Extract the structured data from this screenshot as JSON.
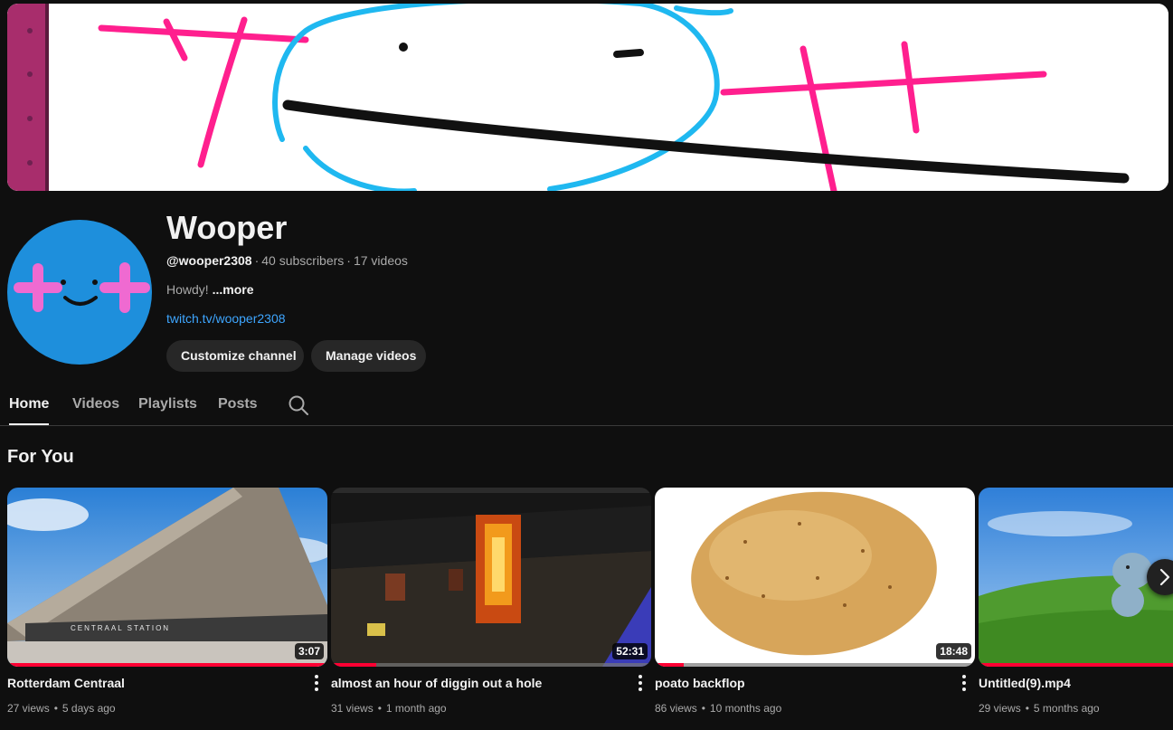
{
  "channel": {
    "name": "Wooper",
    "handle": "@wooper2308",
    "subscribers": "40 subscribers",
    "videos_count": "17 videos",
    "separator": "·",
    "description": "Howdy!",
    "more_label": "...more",
    "link": "twitch.tv/wooper2308",
    "customize_label": "Customize channel",
    "manage_label": "Manage videos"
  },
  "tabs": [
    {
      "label": "Home",
      "active": true
    },
    {
      "label": "Videos",
      "active": false
    },
    {
      "label": "Playlists",
      "active": false
    },
    {
      "label": "Posts",
      "active": false
    }
  ],
  "section": {
    "title": "For You"
  },
  "videos": [
    {
      "title": "Rotterdam Centraal",
      "duration": "3:07",
      "views": "27 views",
      "age": "5 days ago",
      "watched_fraction": 1.0
    },
    {
      "title": "almost an hour of diggin out a hole",
      "duration": "52:31",
      "views": "31 views",
      "age": "1 month ago",
      "watched_fraction": 0.14
    },
    {
      "title": "poato backflop",
      "duration": "18:48",
      "views": "86 views",
      "age": "10 months ago",
      "watched_fraction": 0.09
    },
    {
      "title": "Untitled(9).mp4",
      "duration": "",
      "views": "29 views",
      "age": "5 months ago",
      "watched_fraction": 1.0
    }
  ],
  "stats_separator": "•",
  "colors": {
    "background": "#0f0f0f",
    "accent_link": "#3ea6ff",
    "progress": "#ff0033",
    "pill": "#272727",
    "avatar": "#1e8fdc",
    "avatar_cross": "#ef6ad1"
  },
  "icons": {
    "search": "search-icon",
    "more": "more-vert-icon",
    "next": "chevron-right-icon"
  }
}
